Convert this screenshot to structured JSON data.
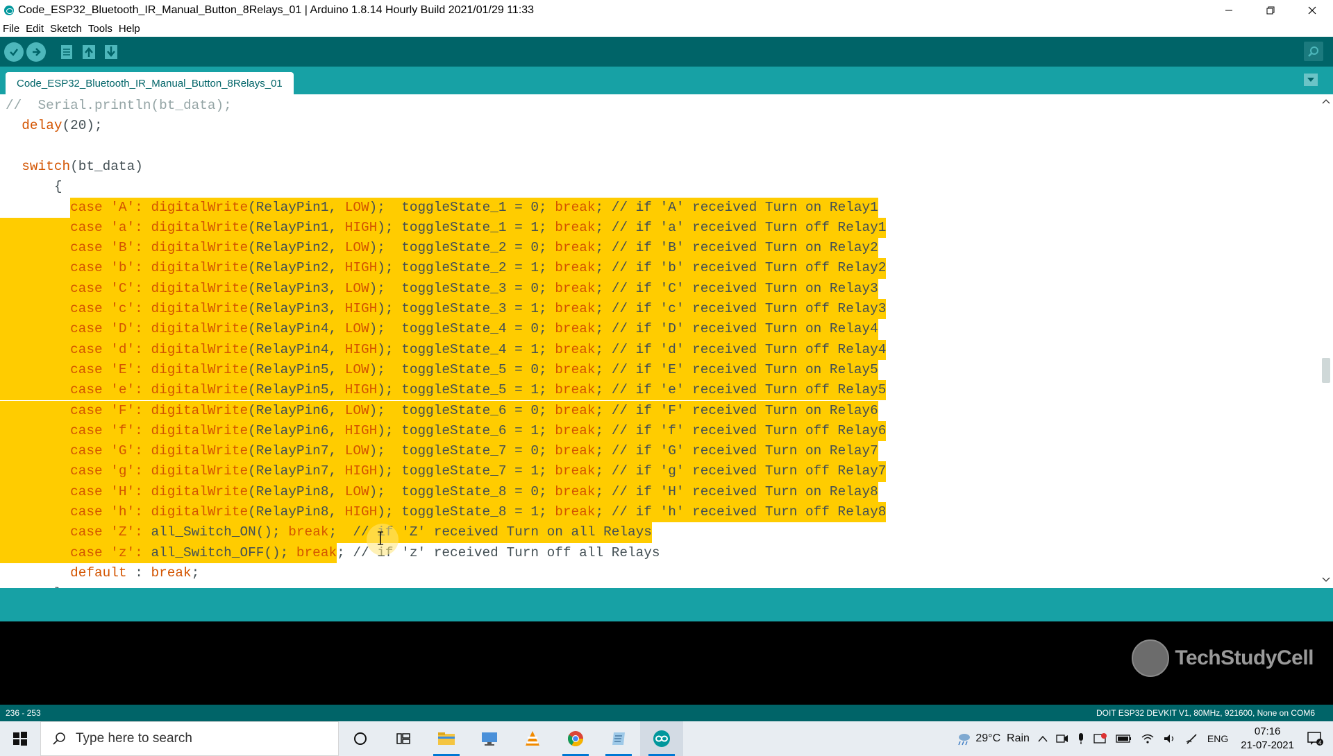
{
  "window": {
    "title": "Code_ESP32_Bluetooth_IR_Manual_Button_8Relays_01 | Arduino 1.8.14 Hourly Build 2021/01/29 11:33"
  },
  "menu": [
    "File",
    "Edit",
    "Sketch",
    "Tools",
    "Help"
  ],
  "toolbar": {
    "buttons": [
      "verify-icon",
      "upload-icon",
      "new-icon",
      "open-icon",
      "save-icon"
    ],
    "serial_monitor": "serial-monitor-icon"
  },
  "tabs": [
    "Code_ESP32_Bluetooth_IR_Manual_Button_8Relays_01"
  ],
  "colors": {
    "accent_dark": "#006468",
    "accent": "#17a1a5",
    "selection": "#ffcc00",
    "keyword": "#d35400",
    "comment": "#95a5a6"
  },
  "code": {
    "lines": [
      {
        "segments": [
          {
            "t": "//  Serial.println(bt_data);",
            "c": "cm"
          }
        ]
      },
      {
        "segments": [
          {
            "t": "  "
          },
          {
            "t": "delay",
            "c": "kw"
          },
          {
            "t": "(20);"
          }
        ]
      },
      {
        "segments": [
          {
            "t": ""
          }
        ]
      },
      {
        "segments": [
          {
            "t": "  "
          },
          {
            "t": "switch",
            "c": "kw"
          },
          {
            "t": "(bt_data)"
          }
        ]
      },
      {
        "segments": [
          {
            "t": "      {"
          }
        ]
      },
      {
        "selected": true,
        "segments": [
          {
            "t": "        case 'A': ",
            "c": "kw"
          },
          {
            "t": "digitalWrite",
            "c": "kw"
          },
          {
            "t": "(RelayPin1, "
          },
          {
            "t": "LOW",
            "c": "kw2"
          },
          {
            "t": ");  toggleState_1 = 0; "
          },
          {
            "t": "break",
            "c": "kw"
          },
          {
            "t": "; // if 'A' received Turn on Relay1",
            "c": "cm"
          }
        ]
      },
      {
        "selected": true,
        "segments": [
          {
            "t": "        case 'a': ",
            "c": "kw"
          },
          {
            "t": "digitalWrite",
            "c": "kw"
          },
          {
            "t": "(RelayPin1, "
          },
          {
            "t": "HIGH",
            "c": "kw2"
          },
          {
            "t": "); toggleState_1 = 1; "
          },
          {
            "t": "break",
            "c": "kw"
          },
          {
            "t": "; // if 'a' received Turn off Relay1",
            "c": "cm"
          }
        ]
      },
      {
        "selected": true,
        "segments": [
          {
            "t": "        case 'B': ",
            "c": "kw"
          },
          {
            "t": "digitalWrite",
            "c": "kw"
          },
          {
            "t": "(RelayPin2, "
          },
          {
            "t": "LOW",
            "c": "kw2"
          },
          {
            "t": ");  toggleState_2 = 0; "
          },
          {
            "t": "break",
            "c": "kw"
          },
          {
            "t": "; // if 'B' received Turn on Relay2",
            "c": "cm"
          }
        ]
      },
      {
        "selected": true,
        "segments": [
          {
            "t": "        case 'b': ",
            "c": "kw"
          },
          {
            "t": "digitalWrite",
            "c": "kw"
          },
          {
            "t": "(RelayPin2, "
          },
          {
            "t": "HIGH",
            "c": "kw2"
          },
          {
            "t": "); toggleState_2 = 1; "
          },
          {
            "t": "break",
            "c": "kw"
          },
          {
            "t": "; // if 'b' received Turn off Relay2",
            "c": "cm"
          }
        ]
      },
      {
        "selected": true,
        "segments": [
          {
            "t": "        case 'C': ",
            "c": "kw"
          },
          {
            "t": "digitalWrite",
            "c": "kw"
          },
          {
            "t": "(RelayPin3, "
          },
          {
            "t": "LOW",
            "c": "kw2"
          },
          {
            "t": ");  toggleState_3 = 0; "
          },
          {
            "t": "break",
            "c": "kw"
          },
          {
            "t": "; // if 'C' received Turn on Relay3",
            "c": "cm"
          }
        ]
      },
      {
        "selected": true,
        "segments": [
          {
            "t": "        case 'c': ",
            "c": "kw"
          },
          {
            "t": "digitalWrite",
            "c": "kw"
          },
          {
            "t": "(RelayPin3, "
          },
          {
            "t": "HIGH",
            "c": "kw2"
          },
          {
            "t": "); toggleState_3 = 1; "
          },
          {
            "t": "break",
            "c": "kw"
          },
          {
            "t": "; // if 'c' received Turn off Relay3",
            "c": "cm"
          }
        ]
      },
      {
        "selected": true,
        "segments": [
          {
            "t": "        case 'D': ",
            "c": "kw"
          },
          {
            "t": "digitalWrite",
            "c": "kw"
          },
          {
            "t": "(RelayPin4, "
          },
          {
            "t": "LOW",
            "c": "kw2"
          },
          {
            "t": ");  toggleState_4 = 0; "
          },
          {
            "t": "break",
            "c": "kw"
          },
          {
            "t": "; // if 'D' received Turn on Relay4",
            "c": "cm"
          }
        ]
      },
      {
        "selected": true,
        "segments": [
          {
            "t": "        case 'd': ",
            "c": "kw"
          },
          {
            "t": "digitalWrite",
            "c": "kw"
          },
          {
            "t": "(RelayPin4, "
          },
          {
            "t": "HIGH",
            "c": "kw2"
          },
          {
            "t": "); toggleState_4 = 1; "
          },
          {
            "t": "break",
            "c": "kw"
          },
          {
            "t": "; // if 'd' received Turn off Relay4",
            "c": "cm"
          }
        ]
      },
      {
        "selected": true,
        "segments": [
          {
            "t": "        case 'E': ",
            "c": "kw"
          },
          {
            "t": "digitalWrite",
            "c": "kw"
          },
          {
            "t": "(RelayPin5, "
          },
          {
            "t": "LOW",
            "c": "kw2"
          },
          {
            "t": ");  toggleState_5 = 0; "
          },
          {
            "t": "break",
            "c": "kw"
          },
          {
            "t": "; // if 'E' received Turn on Relay5",
            "c": "cm"
          }
        ]
      },
      {
        "selected": true,
        "segments": [
          {
            "t": "        case 'e': ",
            "c": "kw"
          },
          {
            "t": "digitalWrite",
            "c": "kw"
          },
          {
            "t": "(RelayPin5, "
          },
          {
            "t": "HIGH",
            "c": "kw2"
          },
          {
            "t": "); toggleState_5 = 1; "
          },
          {
            "t": "break",
            "c": "kw"
          },
          {
            "t": "; // if 'e' received Turn off Relay5",
            "c": "cm"
          }
        ]
      },
      {
        "selected": true,
        "segments": [
          {
            "t": "        case 'F': ",
            "c": "kw"
          },
          {
            "t": "digitalWrite",
            "c": "kw"
          },
          {
            "t": "(RelayPin6, "
          },
          {
            "t": "LOW",
            "c": "kw2"
          },
          {
            "t": ");  toggleState_6 = 0; "
          },
          {
            "t": "break",
            "c": "kw"
          },
          {
            "t": "; // if 'F' received Turn on Relay6",
            "c": "cm"
          }
        ]
      },
      {
        "selected": true,
        "segments": [
          {
            "t": "        case 'f': ",
            "c": "kw"
          },
          {
            "t": "digitalWrite",
            "c": "kw"
          },
          {
            "t": "(RelayPin6, "
          },
          {
            "t": "HIGH",
            "c": "kw2"
          },
          {
            "t": "); toggleState_6 = 1; "
          },
          {
            "t": "break",
            "c": "kw"
          },
          {
            "t": "; // if 'f' received Turn off Relay6",
            "c": "cm"
          }
        ]
      },
      {
        "selected": true,
        "segments": [
          {
            "t": "        case 'G': ",
            "c": "kw"
          },
          {
            "t": "digitalWrite",
            "c": "kw"
          },
          {
            "t": "(RelayPin7, "
          },
          {
            "t": "LOW",
            "c": "kw2"
          },
          {
            "t": ");  toggleState_7 = 0; "
          },
          {
            "t": "break",
            "c": "kw"
          },
          {
            "t": "; // if 'G' received Turn on Relay7",
            "c": "cm"
          }
        ]
      },
      {
        "selected": true,
        "segments": [
          {
            "t": "        case 'g': ",
            "c": "kw"
          },
          {
            "t": "digitalWrite",
            "c": "kw"
          },
          {
            "t": "(RelayPin7, "
          },
          {
            "t": "HIGH",
            "c": "kw2"
          },
          {
            "t": "); toggleState_7 = 1; "
          },
          {
            "t": "break",
            "c": "kw"
          },
          {
            "t": "; // if 'g' received Turn off Relay7",
            "c": "cm"
          }
        ]
      },
      {
        "selected": true,
        "segments": [
          {
            "t": "        case 'H': ",
            "c": "kw"
          },
          {
            "t": "digitalWrite",
            "c": "kw"
          },
          {
            "t": "(RelayPin8, "
          },
          {
            "t": "LOW",
            "c": "kw2"
          },
          {
            "t": ");  toggleState_8 = 0; "
          },
          {
            "t": "break",
            "c": "kw"
          },
          {
            "t": "; // if 'H' received Turn on Relay8",
            "c": "cm"
          }
        ]
      },
      {
        "selected": true,
        "segments": [
          {
            "t": "        case 'h': ",
            "c": "kw"
          },
          {
            "t": "digitalWrite",
            "c": "kw"
          },
          {
            "t": "(RelayPin8, "
          },
          {
            "t": "HIGH",
            "c": "kw2"
          },
          {
            "t": "); toggleState_8 = 1; "
          },
          {
            "t": "break",
            "c": "kw"
          },
          {
            "t": "; // if 'h' received Turn off Relay8",
            "c": "cm"
          }
        ]
      },
      {
        "selected": true,
        "segments": [
          {
            "t": "        case 'Z': ",
            "c": "kw"
          },
          {
            "t": "all_Switch_ON(); "
          },
          {
            "t": "break",
            "c": "kw"
          },
          {
            "t": ";  // if 'Z' received Turn on all Relays",
            "c": "cm"
          }
        ]
      },
      {
        "selected_partial": true,
        "segments": [
          {
            "t": "        case 'z': ",
            "c": "kw"
          },
          {
            "t": "all_Switch_OFF(); "
          },
          {
            "t": "break",
            "c": "kw"
          },
          {
            "t": "; // if 'z' received Turn off all Relays",
            "c": "cm"
          }
        ]
      },
      {
        "segments": [
          {
            "t": "        "
          },
          {
            "t": "default",
            "c": "kw"
          },
          {
            "t": " : "
          },
          {
            "t": "break",
            "c": "kw"
          },
          {
            "t": ";"
          }
        ]
      },
      {
        "segments": [
          {
            "t": "      }"
          }
        ]
      }
    ]
  },
  "console": {
    "brand": "TechStudyCell"
  },
  "status": {
    "lines": "236 - 253",
    "board": "DOIT ESP32 DEVKIT V1, 80MHz, 921600, None on COM6"
  },
  "taskbar": {
    "search_placeholder": "Type here to search",
    "apps": [
      "cortana-icon",
      "task-view-icon",
      "file-explorer-icon",
      "desktop-app-icon",
      "vlc-icon",
      "chrome-icon",
      "notepad-icon",
      "arduino-icon"
    ],
    "weather": "29°C  Rain",
    "language": "ENG",
    "time": "07:16",
    "date": "21-07-2021"
  }
}
